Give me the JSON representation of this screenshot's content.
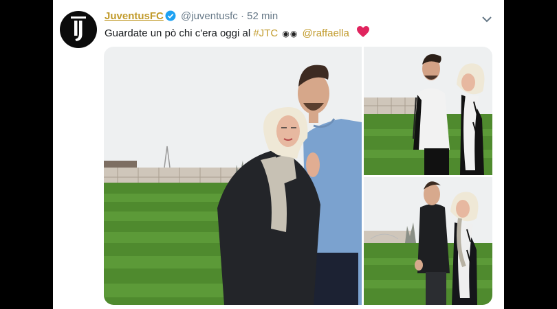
{
  "tweet": {
    "display_name": "JuventusFC",
    "handle": "@juventusfc",
    "separator": "·",
    "time": "52 min",
    "text_prefix": "Guardate un pò chi c'era oggi al ",
    "hashtag": "#JTC",
    "mention": "@raffaella"
  },
  "icons": {
    "avatar": "juventus-logo",
    "verified": "verified-badge-icon",
    "menu": "chevron-down-icon",
    "eyes": "eyes-emoji-icon",
    "heart": "red-heart-emoji-icon"
  },
  "colors": {
    "brand_link": "#c19a2a",
    "verified": "#1da1f2",
    "heart": "#e0245e",
    "text": "#14171a",
    "secondary": "#657786"
  }
}
